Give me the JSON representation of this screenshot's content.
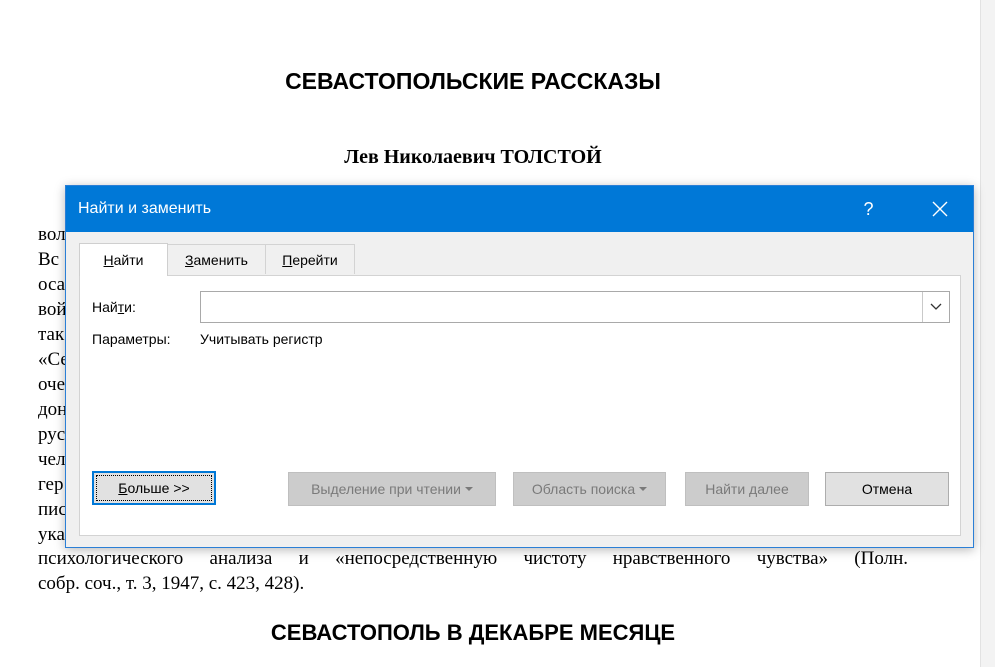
{
  "document": {
    "title": "СЕВАСТОПОЛЬСКИЕ РАССКАЗЫ",
    "author": "Лев Николаевич ТОЛСТОЙ",
    "partial_lines": [
      "вол",
      "Вс",
      "оса",
      "вой",
      "так",
      "«Се",
      "оче",
      "дон",
      "рус",
      "чел",
      "гер",
      "пис",
      "ука"
    ],
    "paragraph_line1": "психологического анализа и «непосредственную чистоту нравственного чувства» (Полн.",
    "paragraph_line2": "собр. соч., т. 3, 1947, с. 423, 428).",
    "section_heading": "СЕВАСТОПОЛЬ В ДЕКАБРЕ МЕСЯЦЕ"
  },
  "dialog": {
    "title": "Найти и заменить",
    "help_label": "?",
    "tabs": [
      {
        "label_pre": "",
        "label_acc": "Н",
        "label_post": "айти",
        "active": true
      },
      {
        "label_pre": "",
        "label_acc": "З",
        "label_post": "аменить",
        "active": false
      },
      {
        "label_pre": "",
        "label_acc": "П",
        "label_post": "ерейти",
        "active": false
      }
    ],
    "find_label_pre": "Най",
    "find_label_acc": "т",
    "find_label_post": "и:",
    "find_value": "",
    "options_label": "Параметры:",
    "options_value": "Учитывать регистр",
    "buttons": {
      "more_pre": "",
      "more_acc": "Б",
      "more_mid": "ольше",
      "more_post": " >>",
      "reading_highlight": "Выделение при чтении",
      "search_scope": "Область поиска",
      "find_next": "Найти далее",
      "cancel": "Отмена"
    }
  },
  "colors": {
    "titlebar": "#0078d7",
    "dialog_bg": "#f0f0f0",
    "disabled_button": "#cccccc"
  }
}
